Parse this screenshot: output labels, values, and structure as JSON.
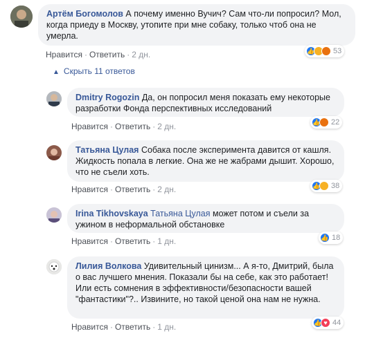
{
  "comments": [
    {
      "author": "Артём Богомолов",
      "text": "А почему именно Вучич? Сам что-ли попросил? Мол, когда приеду в Москву, утопите при мне собаку, только чтоб она не умерла.",
      "like_label": "Нравится",
      "reply_label": "Ответить",
      "time": "2 дн.",
      "reaction_count": "53",
      "reactions": [
        "like",
        "haha",
        "angry"
      ]
    },
    {
      "author": "Dmitry Rogozin",
      "text": "Да, он попросил меня показать ему некоторые разработки Фонда перспективных исследований",
      "like_label": "Нравится",
      "reply_label": "Ответить",
      "time": "2 дн.",
      "reaction_count": "22",
      "reactions": [
        "like",
        "angry"
      ]
    },
    {
      "author": "Татьяна Цулая",
      "text": "Собака после эксперимента давится от кашля. Жидкость попала в легкие. Она же не жабрами дышит. Хорошо, что не съели хоть.",
      "like_label": "Нравится",
      "reply_label": "Ответить",
      "time": "2 дн.",
      "reaction_count": "38",
      "reactions": [
        "like",
        "sad"
      ]
    },
    {
      "author": "Irina Tikhovskaya",
      "mention": "Татьяна Цулая",
      "text": "может потом и съели за ужином в неформальной обстановке",
      "like_label": "Нравится",
      "reply_label": "Ответить",
      "time": "1 дн.",
      "reaction_count": "18",
      "reactions": [
        "like"
      ]
    },
    {
      "author": "Лилия Волкова",
      "text": "Удивительный цинизм... А я-то, Дмитрий, была о вас лучшего мнения. Показали бы на себе, как это работает! Или есть сомнения в эффективности/безопасности вашей \"фантастики\"?.. Извините, но такой ценой она нам не нужна.",
      "like_label": "Нравится",
      "reply_label": "Ответить",
      "time": "1 дн.",
      "reaction_count": "44",
      "reactions": [
        "like",
        "love"
      ]
    }
  ],
  "hide_replies_label": "Скрыть 11 ответов",
  "colors": {
    "author": "#385898",
    "bubble": "#f2f3f5",
    "like": "#2078f4",
    "love": "#f33e58",
    "angry": "#e9710f",
    "haha": "#f7b125"
  }
}
